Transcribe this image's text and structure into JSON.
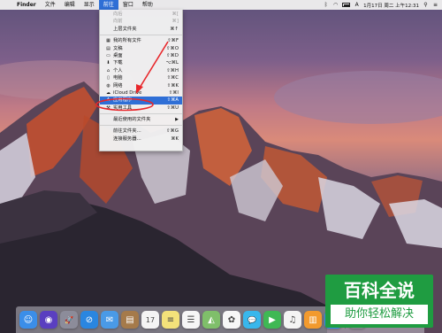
{
  "menubar": {
    "apple_icon": "apple-logo-icon",
    "app_name": "Finder",
    "items": [
      "文件",
      "编辑",
      "显示",
      "前往",
      "窗口",
      "帮助"
    ],
    "active_item": "前往",
    "status": {
      "clock": "1月17日 周二 上午12:31",
      "input_label": "A"
    }
  },
  "go_menu": {
    "rows": [
      {
        "label": "向后",
        "shortcut": "⌘[",
        "disabled": true,
        "icon": ""
      },
      {
        "label": "向前",
        "shortcut": "⌘]",
        "disabled": true,
        "icon": ""
      },
      {
        "label": "上层文件夹",
        "shortcut": "⌘↑",
        "disabled": false,
        "icon": ""
      },
      {
        "sep": true
      },
      {
        "label": "我的所有文件",
        "shortcut": "⇧⌘F",
        "disabled": false,
        "icon": "all-files-icon"
      },
      {
        "label": "文稿",
        "shortcut": "⇧⌘O",
        "disabled": false,
        "icon": "documents-icon"
      },
      {
        "label": "桌面",
        "shortcut": "⇧⌘D",
        "disabled": false,
        "icon": "desktop-icon"
      },
      {
        "label": "下载",
        "shortcut": "⌥⌘L",
        "disabled": false,
        "icon": "downloads-icon"
      },
      {
        "label": "个人",
        "shortcut": "⇧⌘H",
        "disabled": false,
        "icon": "home-icon"
      },
      {
        "label": "电脑",
        "shortcut": "⇧⌘C",
        "disabled": false,
        "icon": "computer-icon"
      },
      {
        "label": "网络",
        "shortcut": "⇧⌘K",
        "disabled": false,
        "icon": "network-icon"
      },
      {
        "label": "iCloud Drive",
        "shortcut": "⇧⌘I",
        "disabled": false,
        "icon": "icloud-icon"
      },
      {
        "label": "应用程序",
        "shortcut": "⇧⌘A",
        "disabled": false,
        "icon": "applications-icon",
        "highlight": true
      },
      {
        "label": "实用工具",
        "shortcut": "⇧⌘U",
        "disabled": false,
        "icon": "utilities-icon"
      },
      {
        "sep": true
      },
      {
        "label": "最近使用的文件夹",
        "shortcut": "",
        "disabled": false,
        "icon": "",
        "submenu": true
      },
      {
        "sep": true
      },
      {
        "label": "前往文件夹…",
        "shortcut": "⇧⌘G",
        "disabled": false,
        "icon": ""
      },
      {
        "label": "连接服务器…",
        "shortcut": "⌘K",
        "disabled": false,
        "icon": ""
      }
    ]
  },
  "dock": {
    "items": [
      {
        "name": "finder-icon",
        "color": "#3b8ee8",
        "glyph": "☺"
      },
      {
        "name": "siri-icon",
        "color": "#5a3fc0",
        "glyph": "◉"
      },
      {
        "name": "launchpad-icon",
        "color": "#8c8c9a",
        "glyph": "🚀"
      },
      {
        "name": "safari-icon",
        "color": "#2a86e0",
        "glyph": "⊘"
      },
      {
        "name": "mail-icon",
        "color": "#4a9ae6",
        "glyph": "✉"
      },
      {
        "name": "contacts-icon",
        "color": "#a57a4a",
        "glyph": "▤"
      },
      {
        "name": "calendar-icon",
        "color": "#f4f4f4",
        "glyph": "17"
      },
      {
        "name": "notes-icon",
        "color": "#f3e27a",
        "glyph": "≡"
      },
      {
        "name": "reminders-icon",
        "color": "#f6f6f6",
        "glyph": "☰"
      },
      {
        "name": "maps-icon",
        "color": "#7fbf6a",
        "glyph": "◭"
      },
      {
        "name": "photos-icon",
        "color": "#f7f7f7",
        "glyph": "✿"
      },
      {
        "name": "messages-icon",
        "color": "#38b7ec",
        "glyph": "💬"
      },
      {
        "name": "facetime-icon",
        "color": "#3fb854",
        "glyph": "▶"
      },
      {
        "name": "itunes-icon",
        "color": "#f4f4f4",
        "glyph": "♫"
      },
      {
        "name": "ibooks-icon",
        "color": "#f29a2e",
        "glyph": "▥"
      },
      {
        "name": "app-store-icon",
        "color": "#2d8ef0",
        "glyph": "A"
      },
      {
        "name": "system-preferences-icon",
        "color": "#8a8a92",
        "glyph": "⚙"
      }
    ]
  },
  "watermark": {
    "top_text": "百科全说",
    "bottom_text": "助你轻松解决"
  }
}
